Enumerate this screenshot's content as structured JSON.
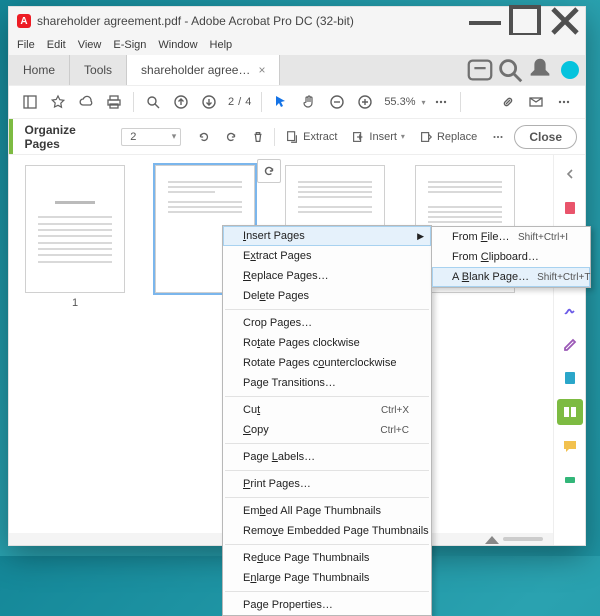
{
  "title": "shareholder agreement.pdf - Adobe Acrobat Pro DC (32-bit)",
  "menu": [
    "File",
    "Edit",
    "View",
    "E-Sign",
    "Window",
    "Help"
  ],
  "tabs": {
    "home": "Home",
    "tools": "Tools",
    "doc": "shareholder agree…"
  },
  "toolbar": {
    "page_current": "2",
    "page_sep": "/",
    "page_total": "4",
    "zoom": "55.3%"
  },
  "orgbar": {
    "title": "Organize Pages",
    "page_select": "2",
    "extract": "Extract",
    "insert": "Insert",
    "replace": "Replace",
    "close": "Close"
  },
  "thumbs": {
    "p1": "1"
  },
  "ctx": {
    "insert_pages": "Insert Pages",
    "extract": "Extract Pages",
    "replace": "Replace Pages…",
    "delete": "Delete Pages",
    "crop": "Crop Pages…",
    "rotcw": "Rotate Pages clockwise",
    "rotccw": "Rotate Pages counterclockwise",
    "trans": "Page Transitions…",
    "cut": "Cut",
    "cut_sc": "Ctrl+X",
    "copy": "Copy",
    "copy_sc": "Ctrl+C",
    "labels": "Page Labels…",
    "print": "Print Pages…",
    "embed": "Embed All Page Thumbnails",
    "remove_embed": "Remove Embedded Page Thumbnails",
    "reduce": "Reduce Page Thumbnails",
    "enlarge": "Enlarge Page Thumbnails",
    "props": "Page Properties…"
  },
  "sub": {
    "from_file": "From File…",
    "from_file_sc": "Shift+Ctrl+I",
    "from_clip": "From Clipboard…",
    "blank": "A Blank Page…",
    "blank_sc": "Shift+Ctrl+T"
  }
}
